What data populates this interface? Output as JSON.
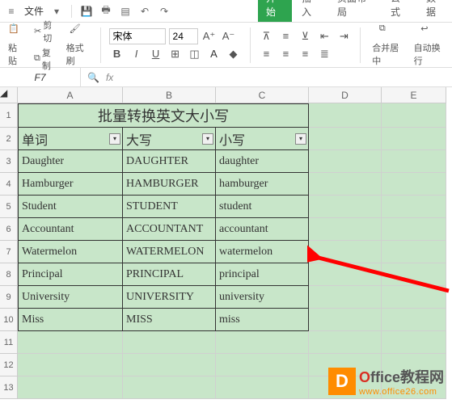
{
  "titlebar": {
    "menu_file": "文件"
  },
  "tabs": {
    "start": "开始",
    "insert": "插入",
    "layout": "页面布局",
    "formula": "公式",
    "data": "数据"
  },
  "ribbon": {
    "cut": "剪切",
    "paste": "粘贴",
    "copy": "复制",
    "format_painter": "格式刷",
    "font_name": "宋体",
    "font_size": "24",
    "merge_center": "合并居中",
    "wrap_text": "自动换行"
  },
  "formula_bar": {
    "cell_ref": "F7",
    "fx": "fx"
  },
  "columns": [
    "A",
    "B",
    "C",
    "D",
    "E"
  ],
  "rows": [
    "1",
    "2",
    "3",
    "4",
    "5",
    "6",
    "7",
    "8",
    "9",
    "10",
    "11",
    "12",
    "13"
  ],
  "sheet": {
    "title": "批量转换英文大小写",
    "headers": {
      "a": "单词",
      "b": "大写",
      "c": "小写"
    },
    "data": [
      {
        "a": "Daughter",
        "b": "DAUGHTER",
        "c": "daughter"
      },
      {
        "a": "Hamburger",
        "b": "HAMBURGER",
        "c": "hamburger"
      },
      {
        "a": "Student",
        "b": "STUDENT",
        "c": "student"
      },
      {
        "a": "Accountant",
        "b": "ACCOUNTANT",
        "c": "accountant"
      },
      {
        "a": "Watermelon",
        "b": "WATERMELON",
        "c": "watermelon"
      },
      {
        "a": "Principal",
        "b": "PRINCIPAL",
        "c": "principal"
      },
      {
        "a": "University",
        "b": "UNIVERSITY",
        "c": "university"
      },
      {
        "a": "Miss",
        "b": "MISS",
        "c": "miss"
      }
    ]
  },
  "watermark": {
    "logo_letter": "D",
    "line1_a": "O",
    "line1_b": "ffice",
    "line1_c": "教程网",
    "line2": "www.office26.com"
  }
}
